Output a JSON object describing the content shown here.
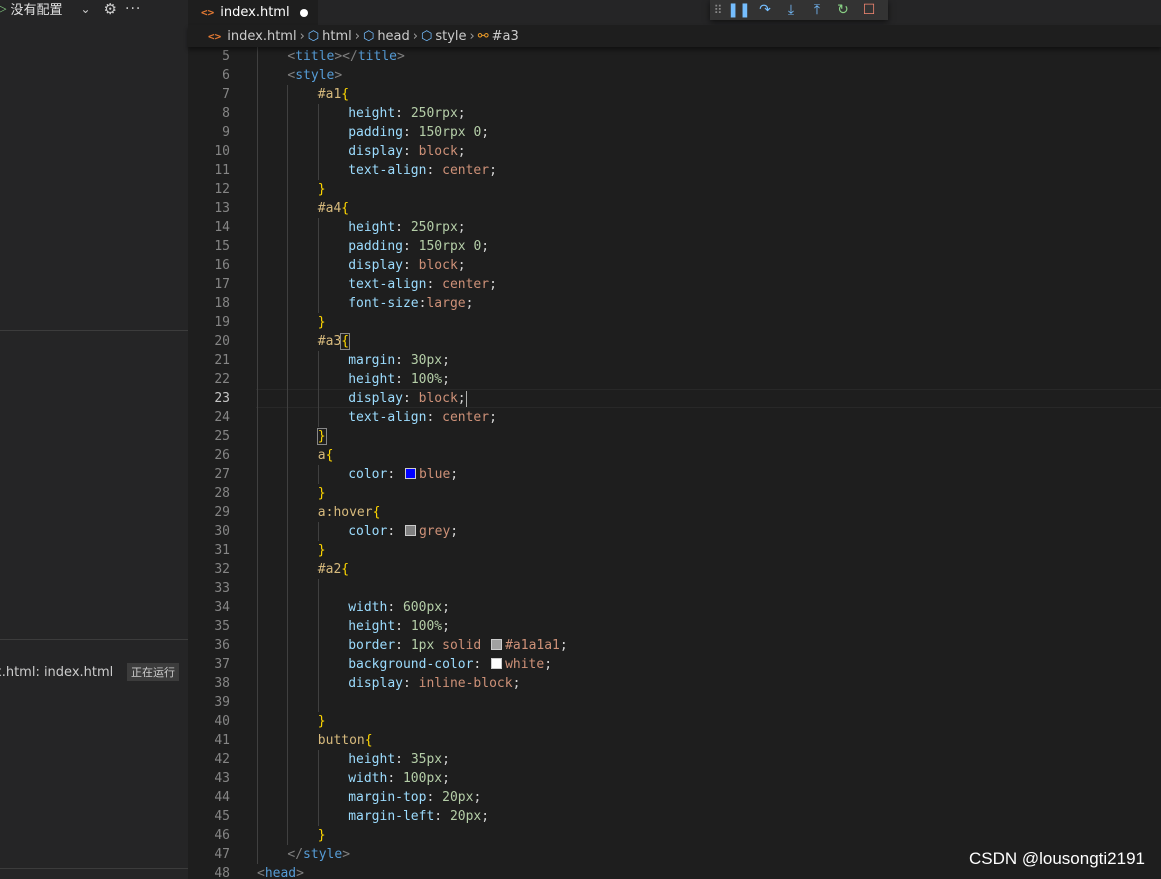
{
  "sidebar": {
    "config_label": "没有配置",
    "callstack_item": "x.html: index.html",
    "callstack_status": "正在运行"
  },
  "tab": {
    "filename": "index.html"
  },
  "breadcrumb": [
    "index.html",
    "html",
    "head",
    "style",
    "#a3"
  ],
  "code_lines": [
    {
      "n": "5",
      "indent": 1,
      "parts": [
        [
          "punc",
          "<"
        ],
        [
          "tag",
          "title"
        ],
        [
          "punc",
          "></"
        ],
        [
          "tag",
          "title"
        ],
        [
          "punc",
          ">"
        ]
      ]
    },
    {
      "n": "6",
      "indent": 1,
      "parts": [
        [
          "punc",
          "<"
        ],
        [
          "tag",
          "style"
        ],
        [
          "punc",
          ">"
        ]
      ]
    },
    {
      "n": "7",
      "indent": 2,
      "parts": [
        [
          "sel",
          "#a1"
        ],
        [
          "brace",
          "{"
        ]
      ]
    },
    {
      "n": "8",
      "indent": 3,
      "parts": [
        [
          "prop",
          "height"
        ],
        [
          "plain",
          ": "
        ],
        [
          "num",
          "250rpx"
        ],
        [
          "plain",
          ";"
        ]
      ]
    },
    {
      "n": "9",
      "indent": 3,
      "parts": [
        [
          "prop",
          "padding"
        ],
        [
          "plain",
          ": "
        ],
        [
          "num",
          "150rpx"
        ],
        [
          "plain",
          " "
        ],
        [
          "num",
          "0"
        ],
        [
          "plain",
          ";"
        ]
      ]
    },
    {
      "n": "10",
      "indent": 3,
      "parts": [
        [
          "prop",
          "display"
        ],
        [
          "plain",
          ": "
        ],
        [
          "val",
          "block"
        ],
        [
          "plain",
          ";"
        ]
      ]
    },
    {
      "n": "11",
      "indent": 3,
      "parts": [
        [
          "prop",
          "text-align"
        ],
        [
          "plain",
          ": "
        ],
        [
          "val",
          "center"
        ],
        [
          "plain",
          ";"
        ]
      ]
    },
    {
      "n": "12",
      "indent": 2,
      "parts": [
        [
          "brace",
          "}"
        ]
      ]
    },
    {
      "n": "13",
      "indent": 2,
      "parts": [
        [
          "sel",
          "#a4"
        ],
        [
          "brace",
          "{"
        ]
      ]
    },
    {
      "n": "14",
      "indent": 3,
      "parts": [
        [
          "prop",
          "height"
        ],
        [
          "plain",
          ": "
        ],
        [
          "num",
          "250rpx"
        ],
        [
          "plain",
          ";"
        ]
      ]
    },
    {
      "n": "15",
      "indent": 3,
      "parts": [
        [
          "prop",
          "padding"
        ],
        [
          "plain",
          ": "
        ],
        [
          "num",
          "150rpx"
        ],
        [
          "plain",
          " "
        ],
        [
          "num",
          "0"
        ],
        [
          "plain",
          ";"
        ]
      ]
    },
    {
      "n": "16",
      "indent": 3,
      "parts": [
        [
          "prop",
          "display"
        ],
        [
          "plain",
          ": "
        ],
        [
          "val",
          "block"
        ],
        [
          "plain",
          ";"
        ]
      ]
    },
    {
      "n": "17",
      "indent": 3,
      "parts": [
        [
          "prop",
          "text-align"
        ],
        [
          "plain",
          ": "
        ],
        [
          "val",
          "center"
        ],
        [
          "plain",
          ";"
        ]
      ]
    },
    {
      "n": "18",
      "indent": 3,
      "parts": [
        [
          "prop",
          "font-size"
        ],
        [
          "plain",
          ":"
        ],
        [
          "val",
          "large"
        ],
        [
          "plain",
          ";"
        ]
      ]
    },
    {
      "n": "19",
      "indent": 2,
      "parts": [
        [
          "brace",
          "}"
        ]
      ]
    },
    {
      "n": "20",
      "indent": 2,
      "parts": [
        [
          "sel",
          "#a3"
        ],
        [
          "brace-box",
          "{"
        ]
      ]
    },
    {
      "n": "21",
      "indent": 3,
      "parts": [
        [
          "prop",
          "margin"
        ],
        [
          "plain",
          ": "
        ],
        [
          "num",
          "30px"
        ],
        [
          "plain",
          ";"
        ]
      ]
    },
    {
      "n": "22",
      "indent": 3,
      "parts": [
        [
          "prop",
          "height"
        ],
        [
          "plain",
          ": "
        ],
        [
          "num",
          "100%"
        ],
        [
          "plain",
          ";"
        ]
      ]
    },
    {
      "n": "23",
      "indent": 3,
      "current": true,
      "parts": [
        [
          "prop",
          "display"
        ],
        [
          "plain",
          ": "
        ],
        [
          "val",
          "block"
        ],
        [
          "plain",
          ";"
        ],
        [
          "cursor",
          ""
        ]
      ]
    },
    {
      "n": "24",
      "indent": 3,
      "parts": [
        [
          "prop",
          "text-align"
        ],
        [
          "plain",
          ": "
        ],
        [
          "val",
          "center"
        ],
        [
          "plain",
          ";"
        ]
      ]
    },
    {
      "n": "25",
      "indent": 2,
      "parts": [
        [
          "brace-box",
          "}"
        ]
      ]
    },
    {
      "n": "26",
      "indent": 2,
      "parts": [
        [
          "sel",
          "a"
        ],
        [
          "brace",
          "{"
        ]
      ]
    },
    {
      "n": "27",
      "indent": 3,
      "parts": [
        [
          "prop",
          "color"
        ],
        [
          "plain",
          ": "
        ],
        [
          "swatch",
          "#0000ff"
        ],
        [
          "val",
          "blue"
        ],
        [
          "plain",
          ";"
        ]
      ]
    },
    {
      "n": "28",
      "indent": 2,
      "parts": [
        [
          "brace",
          "}"
        ]
      ]
    },
    {
      "n": "29",
      "indent": 2,
      "parts": [
        [
          "sel",
          "a:hover"
        ],
        [
          "brace",
          "{"
        ]
      ]
    },
    {
      "n": "30",
      "indent": 3,
      "parts": [
        [
          "prop",
          "color"
        ],
        [
          "plain",
          ": "
        ],
        [
          "swatch",
          "#808080"
        ],
        [
          "val",
          "grey"
        ],
        [
          "plain",
          ";"
        ]
      ]
    },
    {
      "n": "31",
      "indent": 2,
      "parts": [
        [
          "brace",
          "}"
        ]
      ]
    },
    {
      "n": "32",
      "indent": 2,
      "parts": [
        [
          "sel",
          "#a2"
        ],
        [
          "brace",
          "{"
        ]
      ]
    },
    {
      "n": "33",
      "indent": 3,
      "parts": []
    },
    {
      "n": "34",
      "indent": 3,
      "parts": [
        [
          "prop",
          "width"
        ],
        [
          "plain",
          ": "
        ],
        [
          "num",
          "600px"
        ],
        [
          "plain",
          ";"
        ]
      ]
    },
    {
      "n": "35",
      "indent": 3,
      "parts": [
        [
          "prop",
          "height"
        ],
        [
          "plain",
          ": "
        ],
        [
          "num",
          "100%"
        ],
        [
          "plain",
          ";"
        ]
      ]
    },
    {
      "n": "36",
      "indent": 3,
      "parts": [
        [
          "prop",
          "border"
        ],
        [
          "plain",
          ": "
        ],
        [
          "num",
          "1px"
        ],
        [
          "plain",
          " "
        ],
        [
          "val",
          "solid"
        ],
        [
          "plain",
          " "
        ],
        [
          "swatch",
          "#a1a1a1"
        ],
        [
          "val",
          "#a1a1a1"
        ],
        [
          "plain",
          ";"
        ]
      ]
    },
    {
      "n": "37",
      "indent": 3,
      "parts": [
        [
          "prop",
          "background-color"
        ],
        [
          "plain",
          ": "
        ],
        [
          "swatch",
          "#ffffff"
        ],
        [
          "val",
          "white"
        ],
        [
          "plain",
          ";"
        ]
      ]
    },
    {
      "n": "38",
      "indent": 3,
      "parts": [
        [
          "prop",
          "display"
        ],
        [
          "plain",
          ": "
        ],
        [
          "val",
          "inline-block"
        ],
        [
          "plain",
          ";"
        ]
      ]
    },
    {
      "n": "39",
      "indent": 3,
      "parts": []
    },
    {
      "n": "40",
      "indent": 2,
      "parts": [
        [
          "brace",
          "}"
        ]
      ]
    },
    {
      "n": "41",
      "indent": 2,
      "parts": [
        [
          "sel",
          "button"
        ],
        [
          "brace",
          "{"
        ]
      ]
    },
    {
      "n": "42",
      "indent": 3,
      "parts": [
        [
          "prop",
          "height"
        ],
        [
          "plain",
          ": "
        ],
        [
          "num",
          "35px"
        ],
        [
          "plain",
          ";"
        ]
      ]
    },
    {
      "n": "43",
      "indent": 3,
      "parts": [
        [
          "prop",
          "width"
        ],
        [
          "plain",
          ": "
        ],
        [
          "num",
          "100px"
        ],
        [
          "plain",
          ";"
        ]
      ]
    },
    {
      "n": "44",
      "indent": 3,
      "parts": [
        [
          "prop",
          "margin-top"
        ],
        [
          "plain",
          ": "
        ],
        [
          "num",
          "20px"
        ],
        [
          "plain",
          ";"
        ]
      ]
    },
    {
      "n": "45",
      "indent": 3,
      "parts": [
        [
          "prop",
          "margin-left"
        ],
        [
          "plain",
          ": "
        ],
        [
          "num",
          "20px"
        ],
        [
          "plain",
          ";"
        ]
      ]
    },
    {
      "n": "46",
      "indent": 2,
      "parts": [
        [
          "brace",
          "}"
        ]
      ]
    },
    {
      "n": "47",
      "indent": 1,
      "parts": [
        [
          "punc",
          "</"
        ],
        [
          "tag",
          "style"
        ],
        [
          "punc",
          ">"
        ]
      ]
    },
    {
      "n": "48",
      "indent": 0,
      "parts": [
        [
          "punc",
          "<"
        ],
        [
          "tag",
          "head"
        ],
        [
          "punc",
          ">"
        ]
      ]
    }
  ],
  "watermark": "CSDN @lousongti2191",
  "icons": {
    "debug_toolbar": [
      "grip-icon",
      "pause-icon",
      "step-over-icon",
      "step-into-icon",
      "step-out-icon",
      "restart-icon",
      "stop-icon"
    ]
  }
}
